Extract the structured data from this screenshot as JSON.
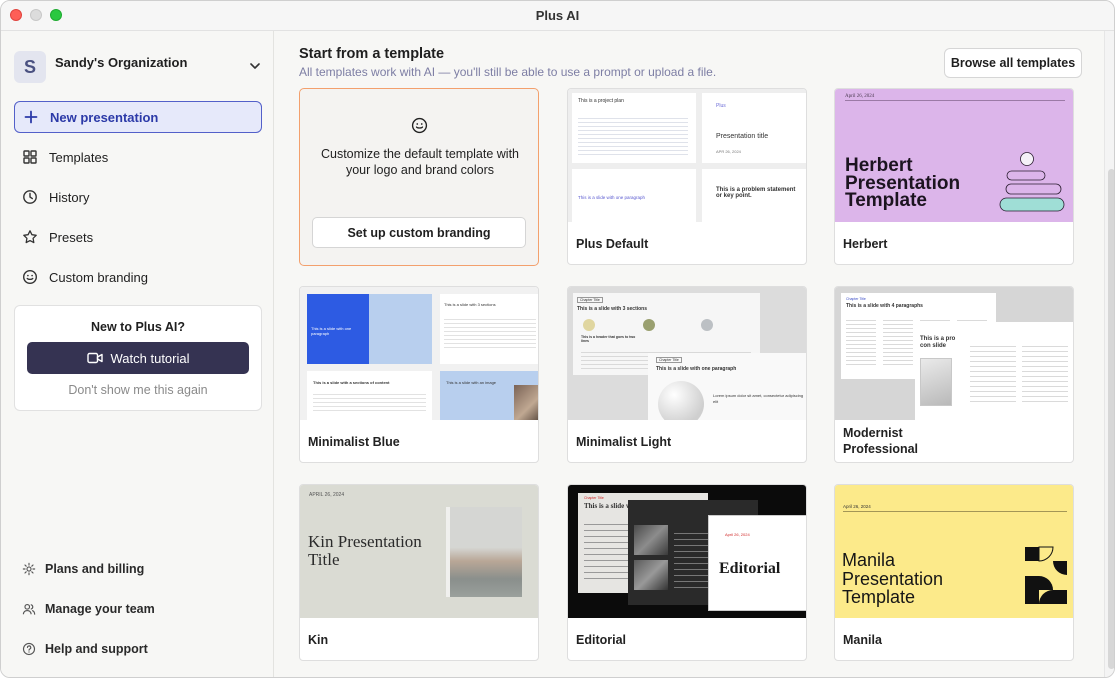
{
  "window": {
    "title": "Plus AI"
  },
  "sidebar": {
    "org": {
      "initial": "S",
      "name": "Sandy's Organization"
    },
    "nav": [
      {
        "label": "New presentation",
        "icon": "plus-icon"
      },
      {
        "label": "Templates",
        "icon": "grid-icon"
      },
      {
        "label": "History",
        "icon": "clock-icon"
      },
      {
        "label": "Presets",
        "icon": "star-icon"
      },
      {
        "label": "Custom branding",
        "icon": "smile-icon"
      }
    ],
    "promo": {
      "title": "New to Plus AI?",
      "button": "Watch tutorial",
      "dismiss": "Don't show me this again"
    },
    "footer": [
      {
        "label": "Plans and billing",
        "icon": "gear-icon"
      },
      {
        "label": "Manage your team",
        "icon": "users-icon"
      },
      {
        "label": "Help and support",
        "icon": "help-icon"
      }
    ]
  },
  "main": {
    "title": "Start from a template",
    "subtitle": "All templates work with AI — you'll still be able to use a prompt or upload a file.",
    "browse_button": "Browse all templates",
    "branding_card": {
      "text": "Customize the default template with your logo and brand colors",
      "button": "Set up custom branding"
    },
    "templates": [
      {
        "label": "Plus Default"
      },
      {
        "label": "Herbert"
      },
      {
        "label": "Minimalist Blue"
      },
      {
        "label": "Minimalist Light"
      },
      {
        "label": "Modernist Professional"
      },
      {
        "label": "Kin"
      },
      {
        "label": "Editorial"
      },
      {
        "label": "Manila"
      }
    ],
    "thumb_text": {
      "plus_default": {
        "plan": "This is a project plan",
        "logo": "Plus",
        "title": "Presentation title",
        "date": "APR 26, 2024",
        "one_para": "This is a slide with one paragraph",
        "problem": "This is a problem statement or key point."
      },
      "herbert": {
        "date": "April 26, 2024",
        "title": "Herbert Presentation Template"
      },
      "minimalist_blue": {
        "one_para": "This is a slide with one paragraph",
        "three_sections": "This is a slide with 3 sections",
        "columns": "This is a slide with a sections of content",
        "image": "This is a slide with an image"
      },
      "minimalist_light": {
        "chapter": "Chapter Title",
        "three_sections": "This is a slide with 3 sections",
        "one_para": "This is a slide with one paragraph",
        "header": "This is a header that goes to two lines",
        "lorem": "Lorem ipsum dolor sit amet, consectetur adipiscing elit"
      },
      "modernist": {
        "label": "Chapter Title",
        "title": "This is a slide with 4 paragraphs",
        "pro": "This is a pro con slide"
      },
      "kin": {
        "date": "APRIL 26, 2024",
        "title": "Kin Presentation Title"
      },
      "editorial": {
        "label": "Chapter Title",
        "slide": "This is a slide with 2 sections",
        "date": "April 26, 2024",
        "title": "Editorial"
      },
      "manila": {
        "date": "April 26, 2024",
        "title": "Manila Presentation Template"
      }
    }
  }
}
